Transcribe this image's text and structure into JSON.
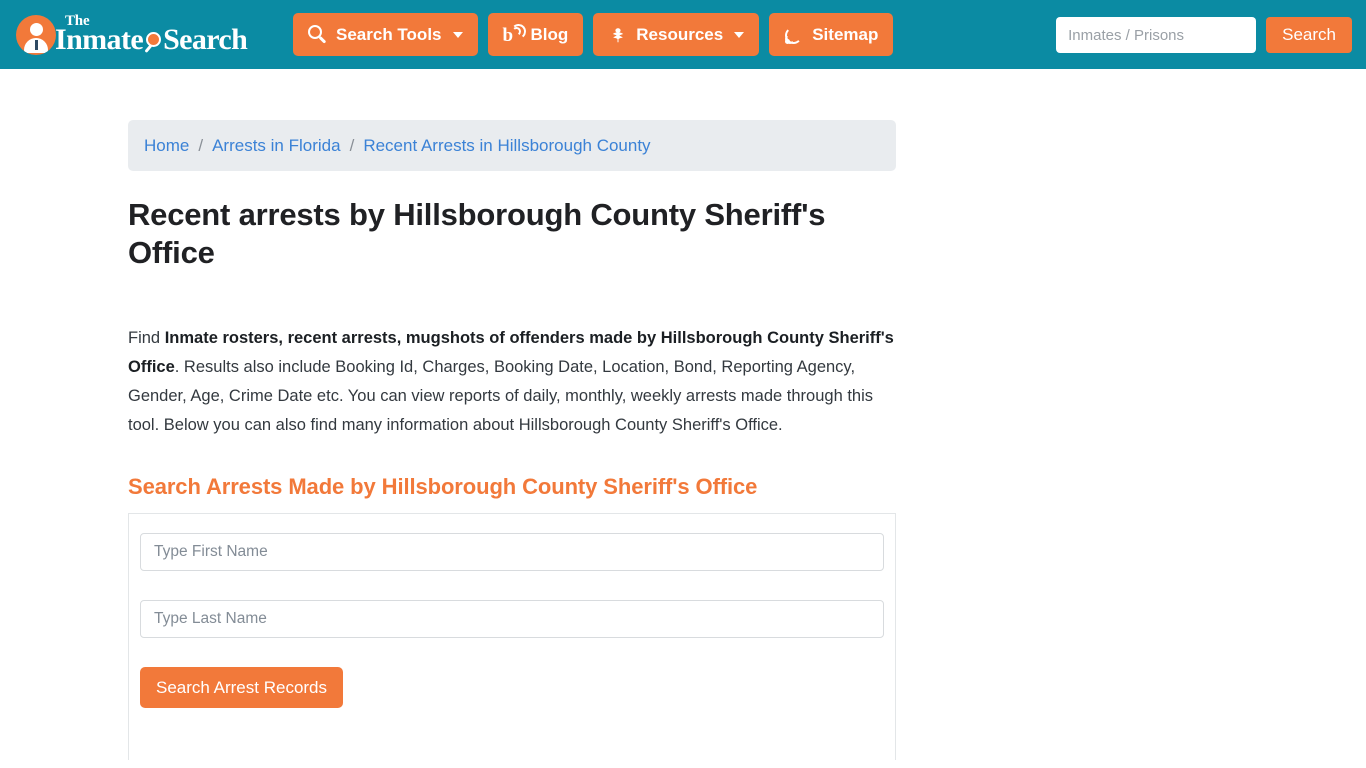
{
  "header": {
    "logo": {
      "the": "The",
      "main_part1": "Inmate",
      "main_part2": "Search",
      "mark_icon": "person-avatar-icon",
      "magnifier_icon": "magnifier-icon"
    },
    "nav": [
      {
        "label": "Search Tools",
        "icon": "search-tools-icon",
        "has_caret": true
      },
      {
        "label": "Blog",
        "icon": "blog-icon",
        "has_caret": false
      },
      {
        "label": "Resources",
        "icon": "leaf-icon",
        "has_caret": true
      },
      {
        "label": "Sitemap",
        "icon": "rss-icon",
        "has_caret": false
      }
    ],
    "search": {
      "value": "",
      "placeholder": "Inmates / Prisons",
      "button_label": "Search"
    }
  },
  "breadcrumb": {
    "items": [
      {
        "label": "Home"
      },
      {
        "label": "Arrests in Florida"
      },
      {
        "label": "Recent Arrests in Hillsborough County"
      }
    ],
    "separator": "/"
  },
  "main": {
    "page_title": "Recent arrests by Hillsborough County Sheriff's Office",
    "intro": {
      "lead": "Find ",
      "bold": "Inmate rosters, recent arrests, mugshots of offenders made by Hillsborough County Sheriff's Office",
      "rest": ". Results also include Booking Id, Charges, Booking Date, Location, Bond, Reporting Agency, Gender, Age, Crime Date etc. You can view reports of daily, monthly, weekly arrests made through this tool. Below you can also find many information about Hillsborough County Sheriff's Office."
    },
    "section_title": "Search Arrests Made by Hillsborough County Sheriff's Office",
    "form": {
      "first_name": {
        "value": "",
        "placeholder": "Type First Name"
      },
      "last_name": {
        "value": "",
        "placeholder": "Type Last Name"
      },
      "submit_label": "Search Arrest Records"
    }
  },
  "colors": {
    "header_teal": "#0b8ba3",
    "accent_orange": "#f2793a",
    "breadcrumb_bg": "#e9ecef",
    "link_blue": "#3b82d6"
  }
}
